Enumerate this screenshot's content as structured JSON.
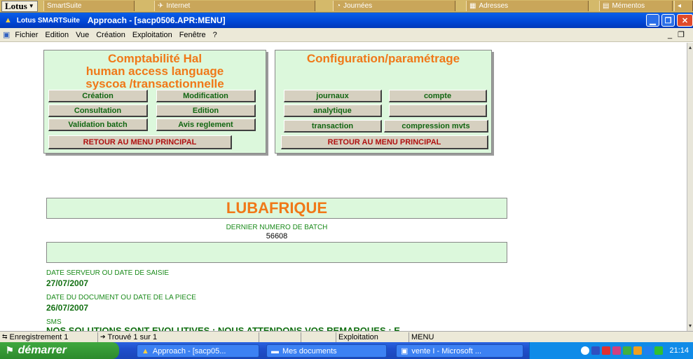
{
  "smartsuite": {
    "lotus_label": "Lotus",
    "items": [
      "SmartSuite",
      "Internet",
      "Journées",
      "Adresses",
      "Mémentos"
    ]
  },
  "window": {
    "app_logo": "Lotus SMARTSuite",
    "title": "Approach - [sacp0506.APR:MENU]"
  },
  "menu": {
    "items": [
      "Fichier",
      "Edition",
      "Vue",
      "Création",
      "Exploitation",
      "Fenêtre",
      "?"
    ]
  },
  "panel_left": {
    "title_lines": [
      "Comptabilité Hal",
      "human access language",
      "syscoa /transactionnelle"
    ],
    "buttons": [
      "Création",
      "Modification",
      "Consultation",
      "Edition",
      "Validation batch",
      "Avis reglement"
    ],
    "return_button": "RETOUR AU MENU PRINCIPAL"
  },
  "panel_right": {
    "title": "Configuration/paramétrage",
    "buttons": [
      "journaux",
      "compte",
      "analytique",
      "",
      "transaction",
      "compression mvts"
    ],
    "return_button": "RETOUR AU MENU PRINCIPAL"
  },
  "company": {
    "name": "LUBAFRIQUE"
  },
  "batch": {
    "label": "DERNIER NUMERO DE BATCH",
    "value": "56608"
  },
  "dates": {
    "server_label": "DATE SERVEUR OU DATE DE SAISIE",
    "server_value": "27/07/2007",
    "doc_label": "DATE DU DOCUMENT OU DATE DE LA PIECE",
    "doc_value": "26/07/2007"
  },
  "sms": {
    "label": "SMS",
    "text": "NOS SOLUTIONS SONT EVOLUTIVES : NOUS ATTENDONS VOS REMARQUES : E"
  },
  "statusbar": {
    "record": "Enregistrement 1",
    "found": "Trouvé 1 sur 1",
    "mode": "Exploitation",
    "view": "MENU"
  },
  "taskbar": {
    "start": "démarrer",
    "tasks": [
      "Approach - [sacp05...",
      "Mes documents",
      "vente I - Microsoft ..."
    ],
    "clock": "21:14"
  },
  "colors": {
    "panel_bg": "#dcf8dc",
    "title_orange": "#f07818",
    "button_green_text": "#116611",
    "button_red_text": "#b01010",
    "titlebar_blue": "#0046d5"
  }
}
